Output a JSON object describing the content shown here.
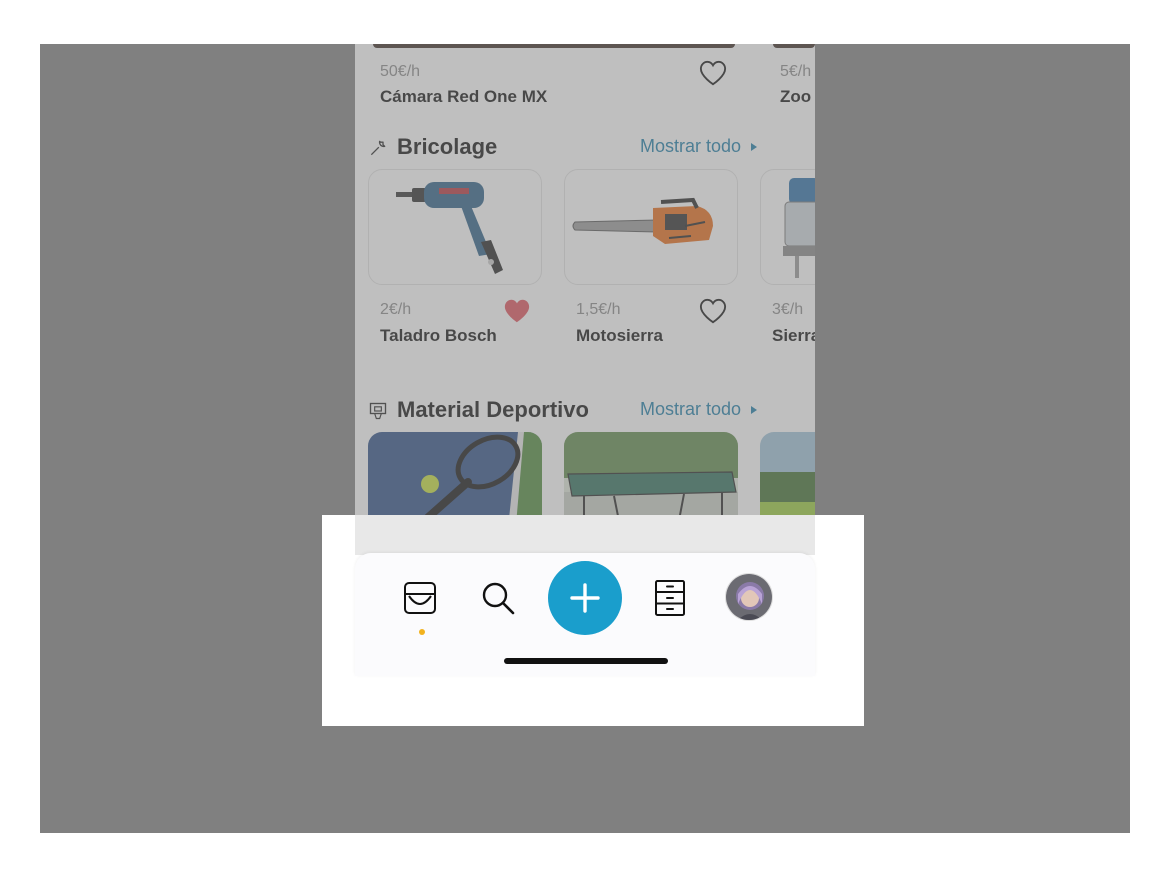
{
  "featured": {
    "items": [
      {
        "price": "50€/h",
        "name": "Cámara Red One MX",
        "favorite": false
      },
      {
        "price": "5€/h",
        "name": "Zoo",
        "favorite": false
      }
    ]
  },
  "sections": [
    {
      "icon": "wrench-icon",
      "title": "Bricolage",
      "show_all": "Mostrar todo",
      "items": [
        {
          "price": "2€/h",
          "name": "Taladro Bosch",
          "favorite": true,
          "image": "drill"
        },
        {
          "price": "1,5€/h",
          "name": "Motosierra",
          "favorite": false,
          "image": "chainsaw"
        },
        {
          "price": "3€/h",
          "name": "Sierra",
          "favorite": false,
          "image": "jigsaw"
        }
      ]
    },
    {
      "icon": "basketball-hoop-icon",
      "title": "Material Deportivo",
      "show_all": "Mostrar todo",
      "items": [
        {
          "image": "tennis-racket"
        },
        {
          "image": "ping-pong-table"
        },
        {
          "image": "field"
        }
      ]
    }
  ],
  "tabbar": {
    "tabs": [
      {
        "icon": "inbox-icon",
        "active": true
      },
      {
        "icon": "search-icon",
        "active": false
      },
      {
        "icon": "plus-icon",
        "active": false
      },
      {
        "icon": "drawers-icon",
        "active": false
      },
      {
        "icon": "avatar",
        "active": false
      }
    ]
  },
  "colors": {
    "accent": "#1b7ca8",
    "fab": "#1a9ecc",
    "favorite": "#e0505a",
    "active_dot": "#f2b21e",
    "overlay": "#808080"
  }
}
